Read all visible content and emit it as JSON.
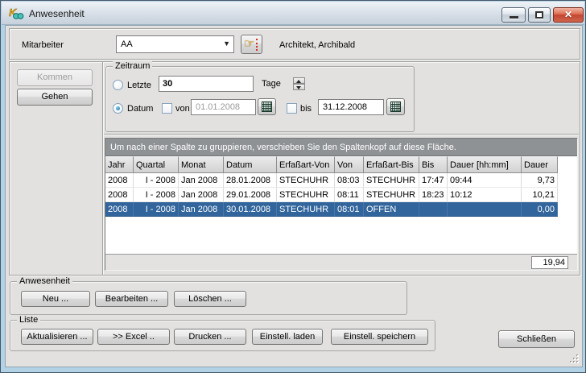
{
  "window": {
    "title": "Anwesenheit"
  },
  "icons": {
    "app": "K-logo",
    "close_glyph": "✕",
    "dropdown_glyph": "▼",
    "browse": "pointing-hand",
    "calendar": "calendar-grid"
  },
  "employee": {
    "label": "Mitarbeiter",
    "selected": "AA",
    "display_name": "Architekt, Archibald"
  },
  "presence_buttons": {
    "kommen": "Kommen",
    "gehen": "Gehen"
  },
  "zeitraum": {
    "title": "Zeitraum",
    "letzte": {
      "label": "Letzte",
      "value": "30",
      "unit": "Tage"
    },
    "datum": {
      "label": "Datum",
      "von_label": "von",
      "von_value": "01.01.2008",
      "bis_label": "bis",
      "bis_value": "31.12.2008"
    }
  },
  "grid": {
    "group_hint": "Um nach einer Spalte zu gruppieren, verschieben Sie den Spaltenkopf auf diese Fläche.",
    "columns": [
      "Jahr",
      "Quartal",
      "Monat",
      "Datum",
      "Erfaßart-Von",
      "Von",
      "Erfaßart-Bis",
      "Bis",
      "Dauer [hh:mm]",
      "Dauer"
    ],
    "rows": [
      [
        "2008",
        "I - 2008",
        "Jan 2008",
        "28.01.2008",
        "STECHUHR",
        "08:03",
        "STECHUHR",
        "17:47",
        "09:44",
        "9,73"
      ],
      [
        "2008",
        "I - 2008",
        "Jan 2008",
        "29.01.2008",
        "STECHUHR",
        "08:11",
        "STECHUHR",
        "18:23",
        "10:12",
        "10,21"
      ],
      [
        "2008",
        "I - 2008",
        "Jan 2008",
        "30.01.2008",
        "STECHUHR",
        "08:01",
        "OFFEN",
        "",
        "",
        "0,00"
      ]
    ],
    "selected_row_index": 2,
    "total": "19,94"
  },
  "anwesenheit_group": {
    "title": "Anwesenheit",
    "neu": "Neu ...",
    "bearbeiten": "Bearbeiten ...",
    "loeschen": "Löschen ..."
  },
  "liste_group": {
    "title": "Liste",
    "aktualisieren": "Aktualisieren ...",
    "excel": ">> Excel ..",
    "drucken": "Drucken ...",
    "einstell_laden": "Einstell. laden",
    "einstell_speichern": "Einstell. speichern"
  },
  "schliessen": "Schließen",
  "colors": {
    "selection_blue": "#31659c",
    "group_band_gray": "#8e9294",
    "close_button_red": "#c14530",
    "client_background": "#e2e1df"
  }
}
